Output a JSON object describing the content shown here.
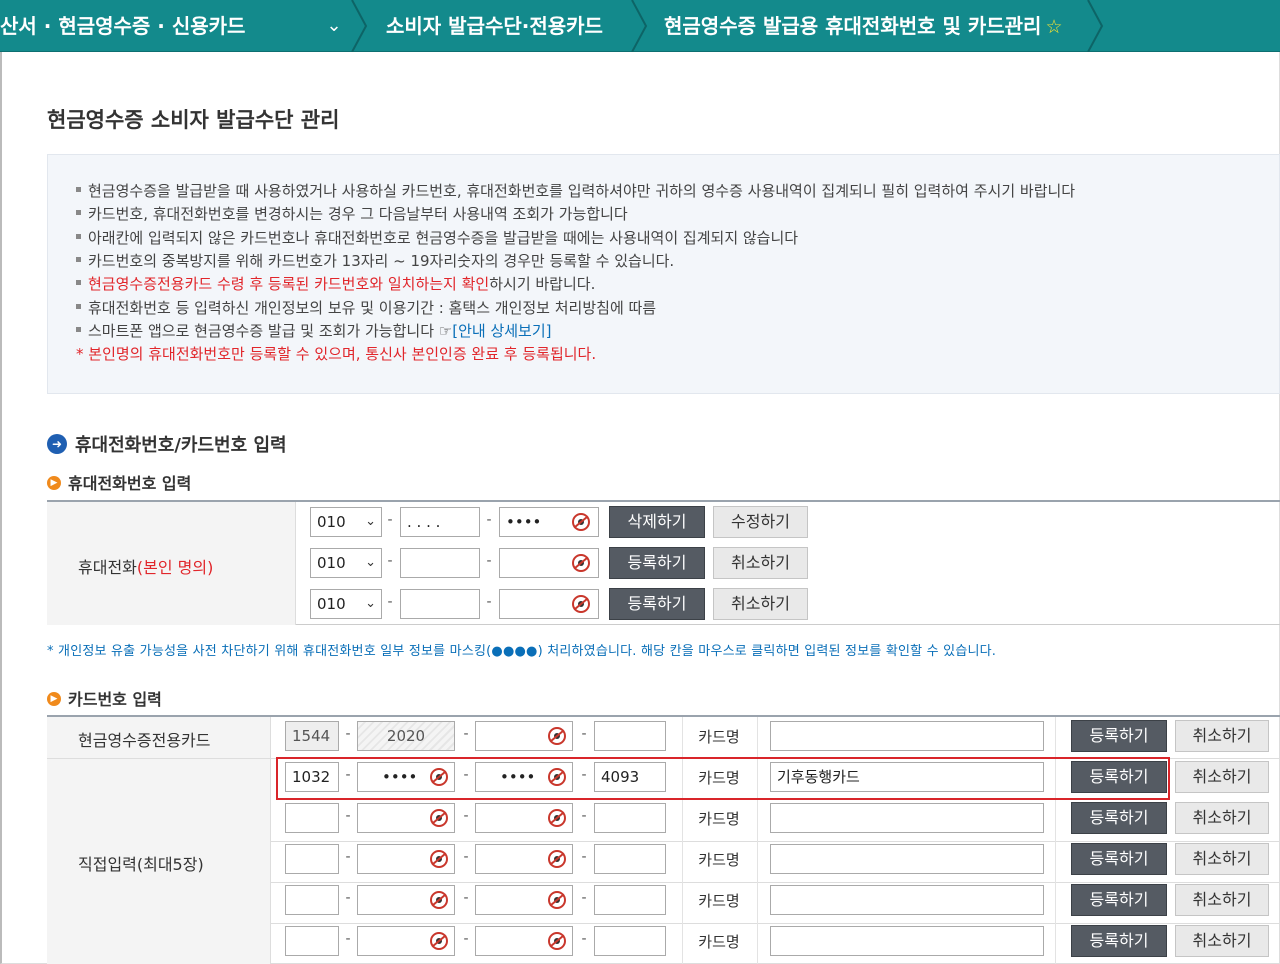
{
  "breadcrumb": {
    "item1": "산서 · 현금영수증 · 신용카드",
    "item2": "소비자 발급수단·전용카드",
    "item3": "현금영수증 발급용 휴대전화번호 및 카드관리"
  },
  "page_title": "현금영수증 소비자 발급수단 관리",
  "info": {
    "line1": "현금영수증을 발급받을 때 사용하였거나 사용하실 카드번호, 휴대전화번호를 입력하셔야만 귀하의 영수증 사용내역이 집계되니 필히 입력하여 주시기 바랍니다",
    "line2": "카드번호, 휴대전화번호를 변경하시는 경우 그 다음날부터 사용내역 조회가 가능합니다",
    "line3": "아래칸에 입력되지 않은 카드번호나 휴대전화번호로 현금영수증을 발급받을 때에는 사용내역이 집계되지 않습니다",
    "line4": "카드번호의 중복방지를 위해 카드번호가 13자리 ~ 19자리숫자의 경우만 등록할 수 있습니다.",
    "line5_red": "현금영수증전용카드 수령 후 등록된 카드번호와 일치하는지 확인",
    "line5_rest": "하시기 바랍니다.",
    "line6": "휴대전화번호 등 입력하신 개인정보의 보유 및 이용기간 : 홈택스 개인정보 처리방침에 따름",
    "line7": "스마트폰 앱으로 현금영수증 발급 및 조회가 가능합니다 ☞",
    "line7_link": "[안내 상세보기]",
    "line8": "* 본인명의 휴대전화번호만 등록할 수 있으며, 통신사 본인인증 완료 후 등록됩니다."
  },
  "section_title": "휴대전화번호/카드번호 입력",
  "phone_section": {
    "title": "휴대전화번호 입력",
    "label": "휴대전화",
    "label_red": "(본인 명의)",
    "rows": [
      {
        "prefix": "010",
        "mid": ". . . .",
        "last": "••••",
        "btn1": "삭제하기",
        "btn2": "수정하기"
      },
      {
        "prefix": "010",
        "mid": "",
        "last": "",
        "btn1": "등록하기",
        "btn2": "취소하기"
      },
      {
        "prefix": "010",
        "mid": "",
        "last": "",
        "btn1": "등록하기",
        "btn2": "취소하기"
      }
    ]
  },
  "notice": "* 개인정보 유출 가능성을 사전 차단하기 위해 휴대전화번호 일부 정보를 마스킹(●●●●) 처리하였습니다. 해당 칸을 마우스로 클릭하면 입력된 정보를 확인할 수 있습니다.",
  "card_section": {
    "title": "카드번호 입력",
    "dedicated_label": "현금영수증전용카드",
    "direct_label": "직접입력(최대5장)",
    "cardname_label": "카드명",
    "rows": [
      {
        "p1": "1544",
        "p2": "2020",
        "p3": "",
        "p4": "",
        "name": "",
        "btn1": "등록하기",
        "btn2": "취소하기"
      },
      {
        "p1": "1032",
        "p2": "••••",
        "p3": "••••",
        "p4": "4093",
        "name": "기후동행카드",
        "btn1": "등록하기",
        "btn2": "취소하기"
      },
      {
        "p1": "",
        "p2": "",
        "p3": "",
        "p4": "",
        "name": "",
        "btn1": "등록하기",
        "btn2": "취소하기"
      },
      {
        "p1": "",
        "p2": "",
        "p3": "",
        "p4": "",
        "name": "",
        "btn1": "등록하기",
        "btn2": "취소하기"
      },
      {
        "p1": "",
        "p2": "",
        "p3": "",
        "p4": "",
        "name": "",
        "btn1": "등록하기",
        "btn2": "취소하기"
      },
      {
        "p1": "",
        "p2": "",
        "p3": "",
        "p4": "",
        "name": "",
        "btn1": "등록하기",
        "btn2": "취소하기"
      }
    ]
  },
  "colors": {
    "topbar": "#138a8c",
    "accent_red": "#e1262b",
    "link_blue": "#0a6fb8",
    "dark_button": "#555b63"
  }
}
